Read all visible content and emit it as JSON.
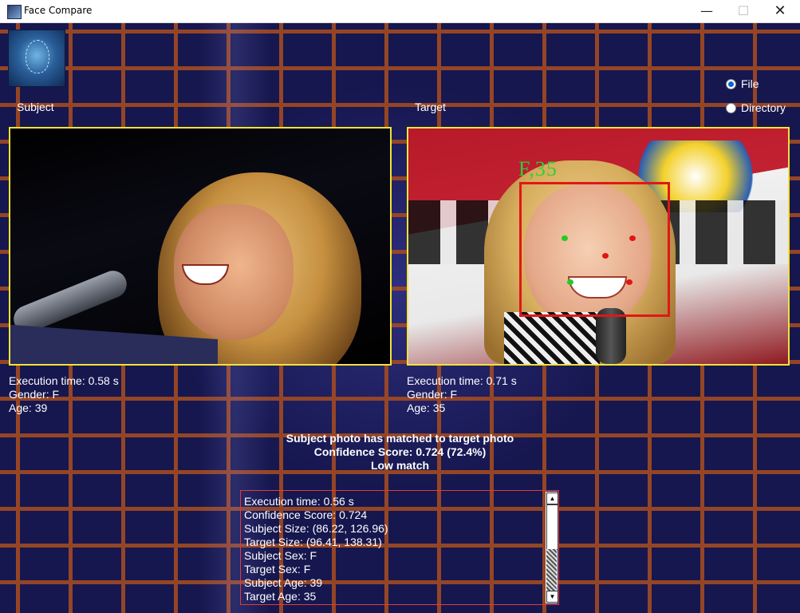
{
  "window": {
    "title": "Face Compare",
    "minimize_glyph": "—",
    "maximize_glyph": "☐",
    "close_glyph": "✕"
  },
  "labels": {
    "subject": "Subject",
    "target": "Target"
  },
  "source_mode": {
    "options": [
      "File",
      "Directory"
    ],
    "selected": "File"
  },
  "subject_info": {
    "execution_time": "Execution time: 0.58 s",
    "gender": "Gender: F",
    "age": "Age: 39"
  },
  "target_info": {
    "execution_time": "Execution time: 0.71 s",
    "gender": "Gender: F",
    "age": "Age: 35"
  },
  "detection": {
    "label": "F,35"
  },
  "result": {
    "line1": "Subject photo has matched to target photo",
    "line2": "Confidence Score: 0.724 (72.4%)",
    "line3": "Low match"
  },
  "log": {
    "lines": [
      "Execution time: 0.56 s",
      "Confidence Score: 0.724",
      "Subject Size: (86.22, 126.96)",
      "Target Size: (96.41, 138.31)",
      "Subject Sex: F",
      "Target Sex: F",
      "Subject Age: 39",
      "Target Age: 35"
    ]
  },
  "colors": {
    "frame_border": "#f2e23a",
    "detection_box": "#e01717",
    "detection_label": "#2fcf3a",
    "log_border": "#e23a3a"
  }
}
